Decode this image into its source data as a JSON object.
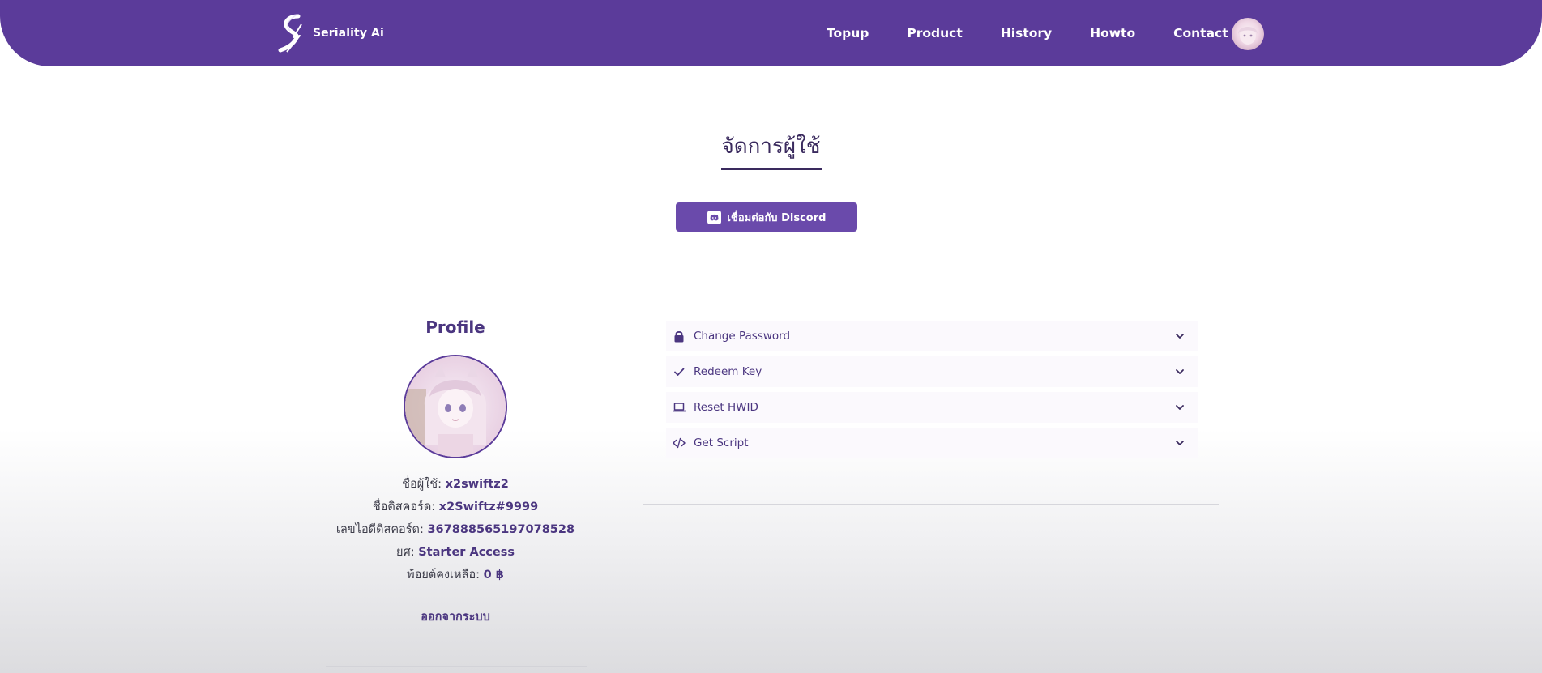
{
  "navbar": {
    "brand_name": "Seriality Ai",
    "links": [
      {
        "label": "Topup"
      },
      {
        "label": "Product"
      },
      {
        "label": "History"
      },
      {
        "label": "Howto"
      },
      {
        "label": "Contact"
      }
    ]
  },
  "page": {
    "title": "จัดการผู้ใช้",
    "discord_button": "เชื่อมต่อกับ Discord"
  },
  "profile": {
    "heading": "Profile",
    "fields": [
      {
        "label": "ชื่อผู้ใช้:",
        "value": "x2swiftz2"
      },
      {
        "label": "ชื่อดิสคอร์ด:",
        "value": "x2Swiftz#9999"
      },
      {
        "label": "เลขไอดีดิสคอร์ด:",
        "value": "367888565197078528"
      },
      {
        "label": "ยศ:",
        "value": "Starter Access"
      },
      {
        "label": "พ้อยต์คงเหลือ:",
        "value": "0 ฿"
      }
    ],
    "logout": "ออกจากระบบ"
  },
  "accordion": [
    {
      "label": "Change Password",
      "icon": "lock-icon"
    },
    {
      "label": "Redeem Key",
      "icon": "check-icon"
    },
    {
      "label": "Reset HWID",
      "icon": "laptop-icon"
    },
    {
      "label": "Get Script",
      "icon": "code-icon"
    }
  ],
  "colors": {
    "primary": "#5b3b9a",
    "button": "#6a4aab",
    "text_accent": "#4b3680"
  }
}
